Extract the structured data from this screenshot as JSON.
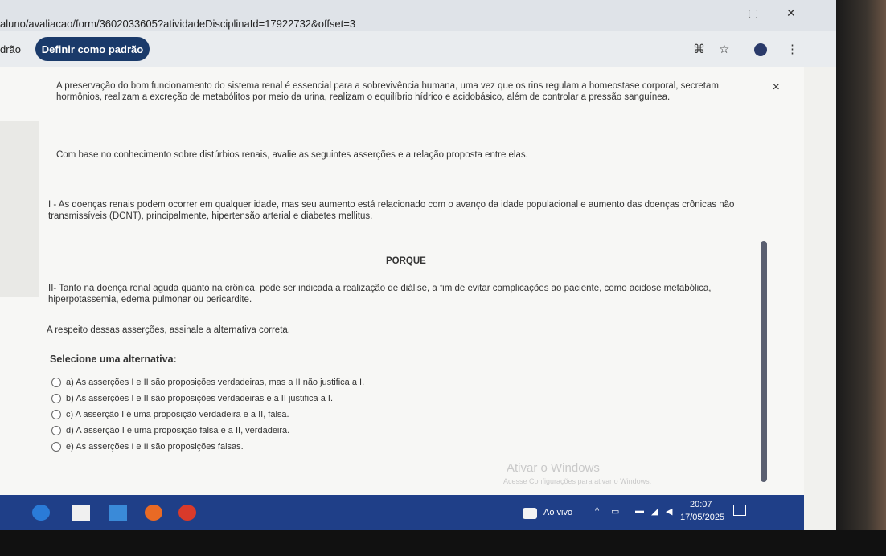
{
  "browser": {
    "url": "aluno/avaliacao/form/3602033605?atividadeDisciplinaId=17922732&offset=3",
    "window_controls": {
      "minimize": "–",
      "maximize": "▢",
      "close": "✕"
    }
  },
  "toolbar": {
    "left_label": "drão",
    "default_button": "Definir como padrão",
    "icons": [
      "translate-icon",
      "star-icon",
      "profile-icon",
      "more-icon"
    ]
  },
  "question": {
    "close_glyph": "×",
    "intro": "A preservação do bom funcionamento do sistema renal é essencial para a sobrevivência humana, uma vez que os rins regulam a homeostase corporal, secretam hormônios, realizam a excreção de metabólitos por meio da urina, realizam o equilíbrio hídrico e acidobásico, além de controlar a pressão sanguínea.",
    "prompt": "Com base no conhecimento sobre distúrbios renais, avalie as seguintes asserções e a relação proposta entre elas.",
    "assertion1": "I - As doenças renais podem ocorrer em qualquer idade, mas seu aumento está relacionado com o avanço da idade populacional e aumento das doenças crônicas não transmissíveis (DCNT), principalmente, hipertensão arterial e diabetes mellitus.",
    "porque": "PORQUE",
    "assertion2": "II- Tanto na doença renal aguda quanto na crônica, pode ser indicada a realização de diálise, a fim de evitar complicações ao paciente, como acidose metabólica, hiperpotassemia, edema pulmonar ou pericardite.",
    "instruction": "A respeito dessas asserções, assinale a alternativa correta.",
    "select_label": "Selecione uma alternativa:",
    "options": [
      "a) As asserções I e II são proposições verdadeiras, mas a II não justifica a I.",
      "b) As asserções I e II são proposições verdadeiras e a II justifica a I.",
      "c) A asserção I é uma proposição verdadeira e a II, falsa.",
      "d) A asserção I é uma proposição falsa e a II, verdadeira.",
      "e) As asserções I e II são proposições falsas."
    ]
  },
  "watermark": {
    "title": "Ativar o Windows",
    "subtitle": "Acesse Configurações para ativar o Windows."
  },
  "taskbar": {
    "live_label": "Ao vivo",
    "time": "20:07",
    "date": "17/05/2025"
  }
}
